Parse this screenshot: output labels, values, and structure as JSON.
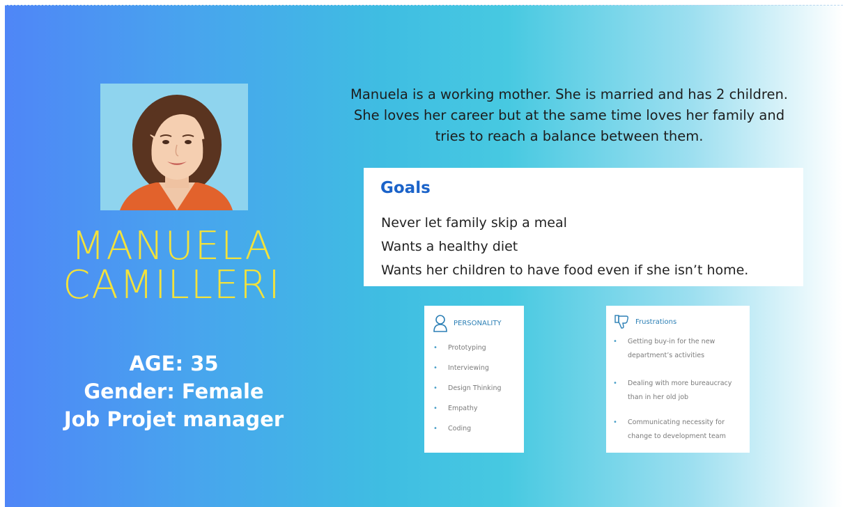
{
  "persona": {
    "name_line1": "MANUELA",
    "name_line2": "CAMILLERI",
    "age": "AGE: 35",
    "gender": "Gender: Female",
    "job": "Job Projet manager"
  },
  "bio": {
    "line1": "Manuela is a working mother. She is married and has 2 children.",
    "line2": "She loves her career but at the same time loves her family and",
    "line3": "tries to reach a balance between them."
  },
  "goals": {
    "title": "Goals",
    "items": [
      "Never let family skip a meal",
      "Wants a healthy diet",
      "Wants her children to have food even if she isn’t home."
    ]
  },
  "personality": {
    "title": "PERSONALITY",
    "icon": "person-outline-icon",
    "items": [
      "Prototyping",
      "Interviewing",
      "Design Thinking",
      "Empathy",
      "Coding"
    ]
  },
  "frustrations": {
    "title": "Frustrations",
    "icon": "thumbs-down-icon",
    "items": [
      "Getting buy-in for the new department’s activities",
      "Dealing with more bureaucracy than in her old job",
      "Communicating necessity for change to development team"
    ]
  },
  "colors": {
    "name": "#f3e23b",
    "goals_title": "#1b63c9",
    "card_accent": "#2b7fb5",
    "gradient_left": "#4f86f7",
    "gradient_right": "#ffffff"
  }
}
